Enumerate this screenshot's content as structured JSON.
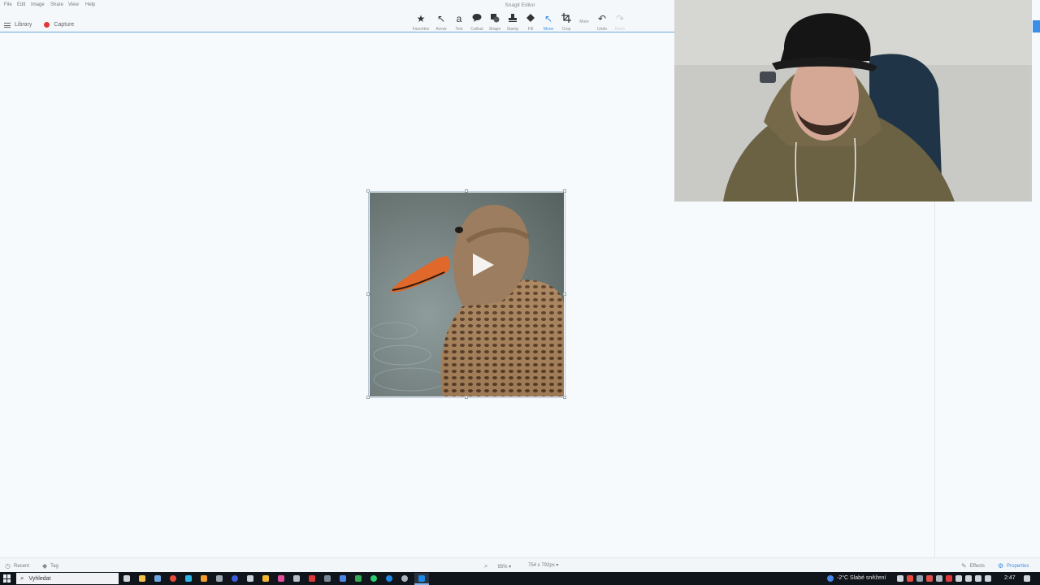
{
  "app": {
    "title": "Snagit Editor"
  },
  "menu": [
    "File",
    "Edit",
    "Image",
    "Share",
    "View",
    "Help"
  ],
  "library": {
    "library_label": "Library",
    "capture_label": "Capture"
  },
  "tools": [
    {
      "label": "Favorites",
      "icon": "star-icon",
      "glyph": "★",
      "state": "normal"
    },
    {
      "label": "Arrow",
      "icon": "arrow-icon",
      "glyph": "↖",
      "state": "normal"
    },
    {
      "label": "Text",
      "icon": "text-icon",
      "glyph": "a",
      "state": "normal"
    },
    {
      "label": "Callout",
      "icon": "callout-icon",
      "glyph": "💬",
      "state": "normal"
    },
    {
      "label": "Shape",
      "icon": "shape-icon",
      "glyph": "◼",
      "state": "normal"
    },
    {
      "label": "Stamp",
      "icon": "stamp-icon",
      "glyph": "⊥",
      "state": "normal"
    },
    {
      "label": "Fill",
      "icon": "fill-icon",
      "glyph": "◆",
      "state": "normal"
    },
    {
      "label": "Move",
      "icon": "move-pointer-icon",
      "glyph": "↖",
      "state": "active"
    },
    {
      "label": "Crop",
      "icon": "crop-icon",
      "glyph": "⌗",
      "state": "normal"
    },
    {
      "label": "More",
      "icon": "more-icon",
      "glyph": "",
      "state": "normal"
    },
    {
      "label": "Undo",
      "icon": "undo-icon",
      "glyph": "↶",
      "state": "normal"
    },
    {
      "label": "Redo",
      "icon": "redo-icon",
      "glyph": "↷",
      "state": "disabled"
    }
  ],
  "status": {
    "recent": "Recent",
    "tag": "Tag",
    "zoom": "95% ▾",
    "dimensions": "754 x 792px ▾",
    "effects": "Effects",
    "properties": "Properties"
  },
  "taskbar": {
    "search_placeholder": "Vyhledat",
    "weather": "-2°C  Slabé sněžení",
    "time": "2:47"
  },
  "colors": {
    "accent": "#3a8ee6",
    "record": "#e0393a",
    "taskbar": "#10141b"
  }
}
